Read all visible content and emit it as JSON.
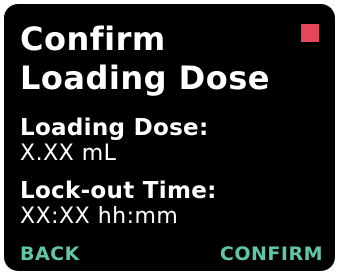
{
  "header": {
    "title_line1": "Confirm",
    "title_line2": "Loading Dose"
  },
  "fields": {
    "loading_dose_label": "Loading Dose:",
    "loading_dose_value": "X.XX mL",
    "lockout_time_label": "Lock-out Time:",
    "lockout_time_value": "XX:XX hh:mm"
  },
  "softkeys": {
    "back_label": "BACK",
    "confirm_label": "CONFIRM"
  },
  "colors": {
    "background": "#000000",
    "text": "#ffffff",
    "softkey": "#5fc6a6",
    "status_indicator": "#e8465a"
  },
  "icons": {
    "status_indicator": "status-square-icon"
  }
}
